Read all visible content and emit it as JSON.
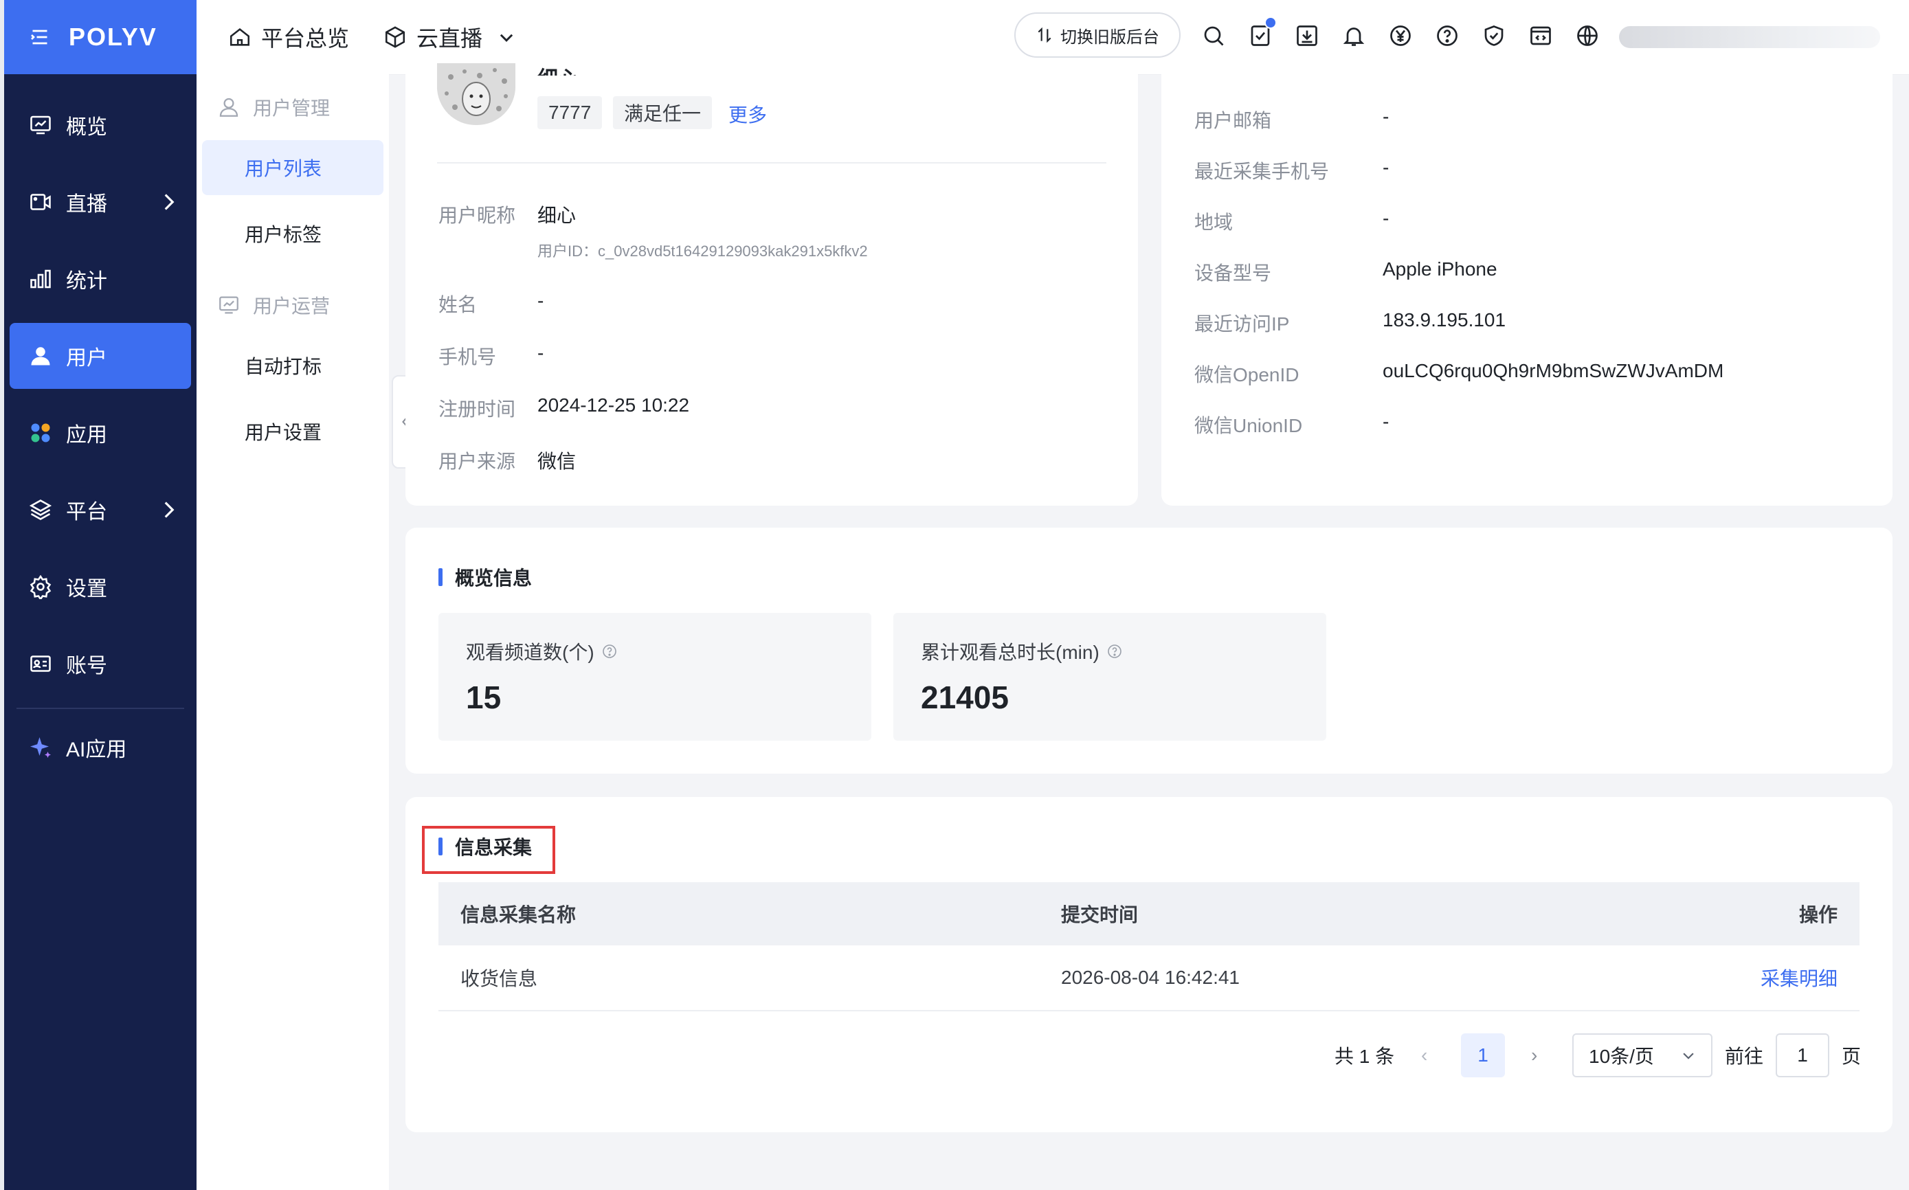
{
  "brand": {
    "logo_text": "POLYV"
  },
  "topbar": {
    "overview": "平台总览",
    "product": "云直播",
    "switch_label": "切换旧版后台",
    "icons": [
      "search-icon",
      "task-icon",
      "download-icon",
      "bell-icon",
      "yuan-icon",
      "help-icon",
      "shield-icon",
      "code-icon",
      "globe-icon"
    ]
  },
  "sidebar": {
    "items": [
      {
        "label": "概览",
        "icon": "monitor-chart-icon"
      },
      {
        "label": "直播",
        "icon": "video-camera-icon"
      },
      {
        "label": "统计",
        "icon": "bar-chart-icon"
      },
      {
        "label": "用户",
        "icon": "user-icon"
      },
      {
        "label": "应用",
        "icon": "apps-grid-icon"
      },
      {
        "label": "平台",
        "icon": "layers-icon"
      },
      {
        "label": "设置",
        "icon": "gear-icon"
      },
      {
        "label": "账号",
        "icon": "id-card-icon"
      },
      {
        "label": "AI应用",
        "icon": "sparkle-icon"
      }
    ],
    "active": "用户"
  },
  "subnav": {
    "group1": "用户管理",
    "items1": [
      "用户列表",
      "用户标签"
    ],
    "group2": "用户运营",
    "items2": [
      "自动打标",
      "用户设置"
    ],
    "active": "用户列表"
  },
  "profile": {
    "name_partial": "细心",
    "tags": [
      "7777",
      "满足任一"
    ],
    "more": "更多",
    "fields": {
      "nickname_label": "用户昵称",
      "nickname": "细心",
      "userid_label": "用户ID：",
      "userid": "c_0v28vd5t16429129093kak291x5kfkv2",
      "name_label": "姓名",
      "name": "-",
      "phone_label": "手机号",
      "phone": "-",
      "reg_label": "注册时间",
      "reg": "2024-12-25 10:22",
      "source_label": "用户来源",
      "source": "微信"
    }
  },
  "details": {
    "email_label": "用户邮箱",
    "email": "-",
    "collect_phone_label": "最近采集手机号",
    "collect_phone": "-",
    "region_label": "地域",
    "region": "-",
    "device_label": "设备型号",
    "device": "Apple iPhone",
    "ip_label": "最近访问IP",
    "ip": "183.9.195.101",
    "openid_label": "微信OpenID",
    "openid": "ouLCQ6rqu0Qh9rM9bmSwZWJvAmDM",
    "unionid_label": "微信UnionID",
    "unionid": "-"
  },
  "overview": {
    "title": "概览信息",
    "stats": [
      {
        "label": "观看频道数(个)",
        "value": "15"
      },
      {
        "label": "累计观看总时长(min)",
        "value": "21405"
      }
    ]
  },
  "collection": {
    "title": "信息采集",
    "columns": [
      "信息采集名称",
      "提交时间",
      "操作"
    ],
    "rows": [
      {
        "name": "收货信息",
        "time": "2026-08-04 16:42:41",
        "action": "采集明细"
      }
    ]
  },
  "pagination": {
    "total": "共 1 条",
    "prev": "‹",
    "current": "1",
    "next": "›",
    "page_size": "10条/页",
    "goto_label": "前往",
    "goto_value": "1",
    "page_suffix": "页"
  },
  "colors": {
    "primary": "#3d6ef0",
    "sidebar": "#15204a",
    "highlight": "#e33b3b"
  }
}
